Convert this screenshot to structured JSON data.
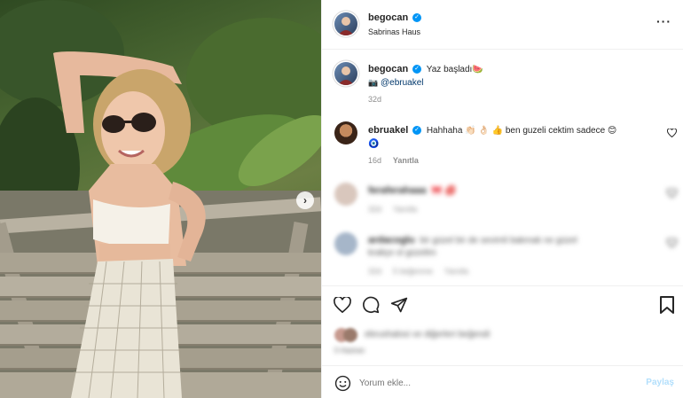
{
  "header": {
    "username": "begocan",
    "location": "Sabrinas Haus",
    "more_label": "···"
  },
  "caption": {
    "username": "begocan",
    "text": "Yaz başladı🍉",
    "mention_icon": "📷",
    "mention": "@ebruakel",
    "time": "32d"
  },
  "comments": [
    {
      "username": "ebruakel",
      "text": "Hahhaha 👏🏻 👌🏻 👍 ben guzeli cektim sadece 😊",
      "badge": "🧿",
      "time": "16d",
      "reply_label": "Yanıtla"
    },
    {
      "username": "feraferahaaa",
      "text": "🎀 💋",
      "time": "32d",
      "reply_label": "Yanıtla"
    },
    {
      "username": "ardacoglu",
      "text": "bir güzel bir de sevimli bakmak ne güzel",
      "text2": "kraliçe ol güzelim",
      "time": "32d",
      "likes_label": "5 beğenme",
      "reply_label": "Yanıtla"
    }
  ],
  "likes": {
    "text": "ebrushalosi ve diğerleri beğendi",
    "date": "5 Haziran"
  },
  "comment_box": {
    "placeholder": "Yorum ekle...",
    "post_label": "Paylaş"
  },
  "icons": {
    "like": "heart-icon",
    "comment": "comment-icon",
    "share": "paper-plane-icon",
    "save": "bookmark-icon",
    "emoji": "smiley-icon",
    "next": "chevron-right-icon"
  },
  "colors": {
    "verified": "#0095f6",
    "link": "#00376b",
    "post_disabled": "#b2dffc"
  }
}
